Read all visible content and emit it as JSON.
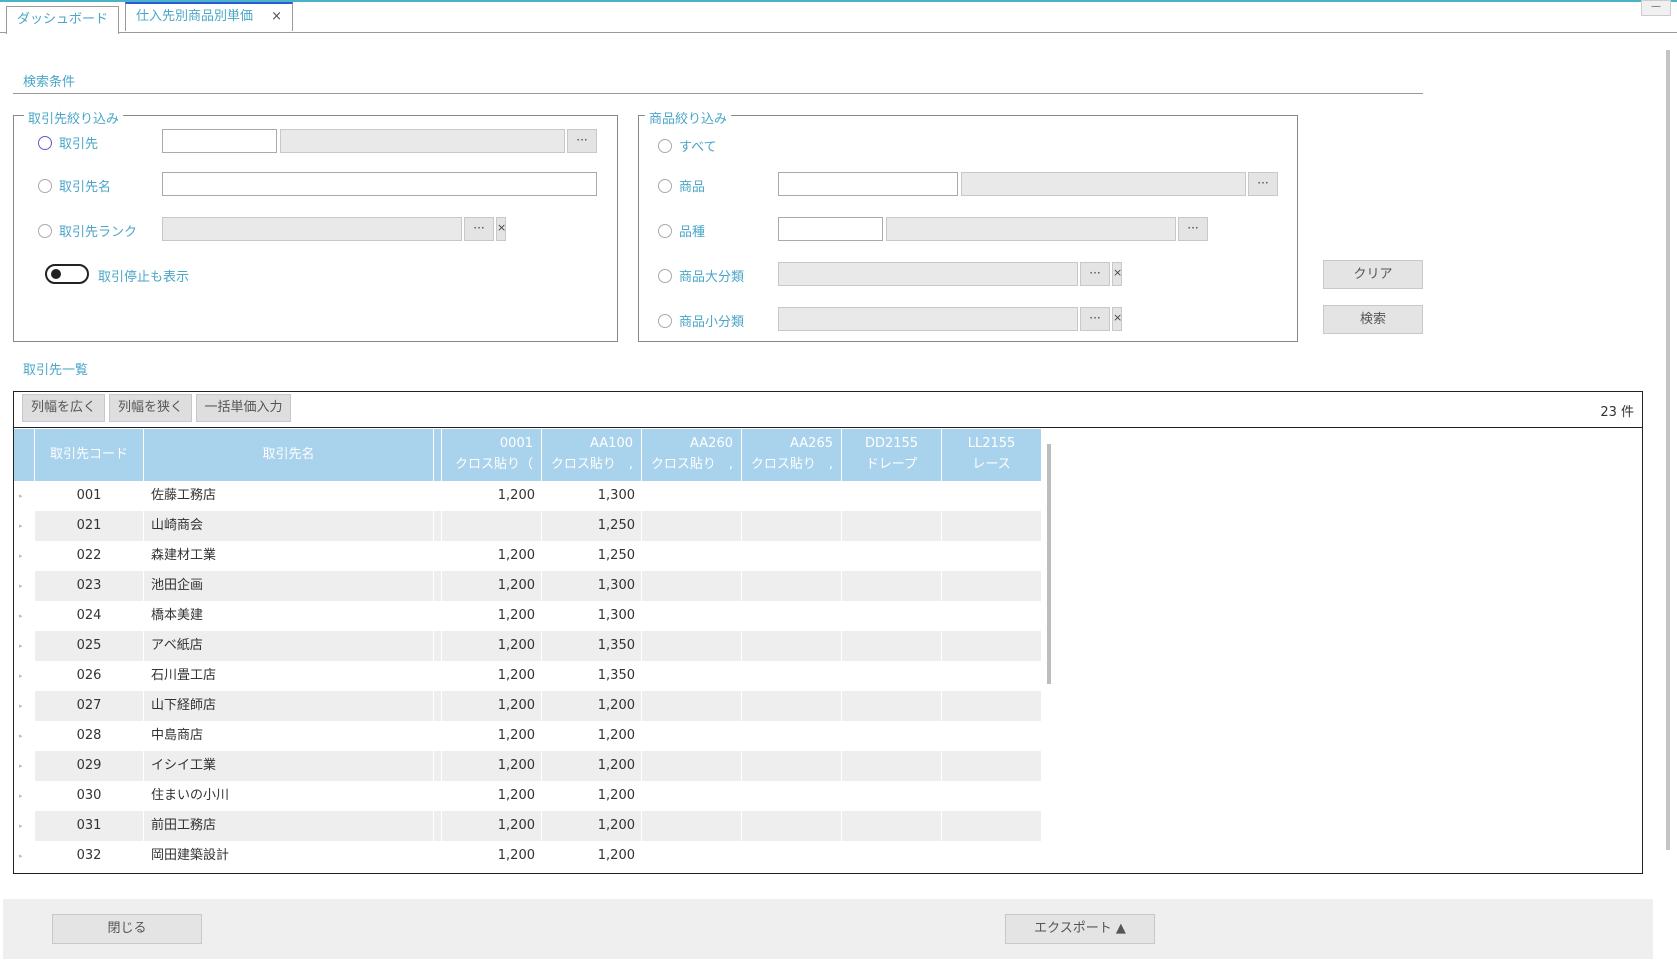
{
  "tabs": [
    {
      "label": "ダッシュボード"
    },
    {
      "label": "仕入先別商品別単価",
      "close": "×"
    }
  ],
  "window": {
    "minimize": "—"
  },
  "search": {
    "title": "検索条件",
    "supplier_group": {
      "legend": "取引先絞り込み",
      "radio_supplier": "取引先",
      "radio_supplier_name": "取引先名",
      "radio_supplier_rank": "取引先ランク",
      "toggle_label": "取引停止も表示",
      "ellipsis": "···",
      "x": "×"
    },
    "product_group": {
      "legend": "商品絞り込み",
      "radio_all": "すべて",
      "radio_product": "商品",
      "radio_variety": "品種",
      "radio_major": "商品大分類",
      "radio_minor": "商品小分類",
      "ellipsis": "···",
      "x": "×"
    },
    "clear_button": "クリア",
    "search_button": "検索"
  },
  "list": {
    "title": "取引先一覧",
    "widen_button": "列幅を広く",
    "narrow_button": "列幅を狭く",
    "bulk_button": "一括単価入力",
    "count": "23 件",
    "headers": {
      "code": "取引先コード",
      "name": "取引先名",
      "p1_code": "0001",
      "p1_name": "クロス貼り（",
      "p2_code": "AA100",
      "p2_name": "クロス貼り　,",
      "p3_code": "AA260",
      "p3_name": "クロス貼り　,",
      "p4_code": "AA265",
      "p4_name": "クロス貼り　,",
      "p5_code": "DD2155",
      "p5_name": "ドレープ",
      "p6_code": "LL2155",
      "p6_name": "レース"
    },
    "rows": [
      {
        "code": "001",
        "name": "佐藤工務店",
        "p1": "1,200",
        "p2": "1,300"
      },
      {
        "code": "021",
        "name": "山崎商会",
        "p1": "",
        "p2": "1,250"
      },
      {
        "code": "022",
        "name": "森建材工業",
        "p1": "1,200",
        "p2": "1,250"
      },
      {
        "code": "023",
        "name": "池田企画",
        "p1": "1,200",
        "p2": "1,300"
      },
      {
        "code": "024",
        "name": "橋本美建",
        "p1": "1,200",
        "p2": "1,300"
      },
      {
        "code": "025",
        "name": "アベ紙店",
        "p1": "1,200",
        "p2": "1,350"
      },
      {
        "code": "026",
        "name": "石川畳工店",
        "p1": "1,200",
        "p2": "1,350"
      },
      {
        "code": "027",
        "name": "山下経師店",
        "p1": "1,200",
        "p2": "1,200"
      },
      {
        "code": "028",
        "name": "中島商店",
        "p1": "1,200",
        "p2": "1,200"
      },
      {
        "code": "029",
        "name": "イシイ工業",
        "p1": "1,200",
        "p2": "1,200"
      },
      {
        "code": "030",
        "name": "住まいの小川",
        "p1": "1,200",
        "p2": "1,200"
      },
      {
        "code": "031",
        "name": "前田工務店",
        "p1": "1,200",
        "p2": "1,200"
      },
      {
        "code": "032",
        "name": "岡田建築設計",
        "p1": "1,200",
        "p2": "1,200"
      }
    ]
  },
  "footer": {
    "close_button": "閉じる",
    "export_button": "エクスポート ▲"
  }
}
